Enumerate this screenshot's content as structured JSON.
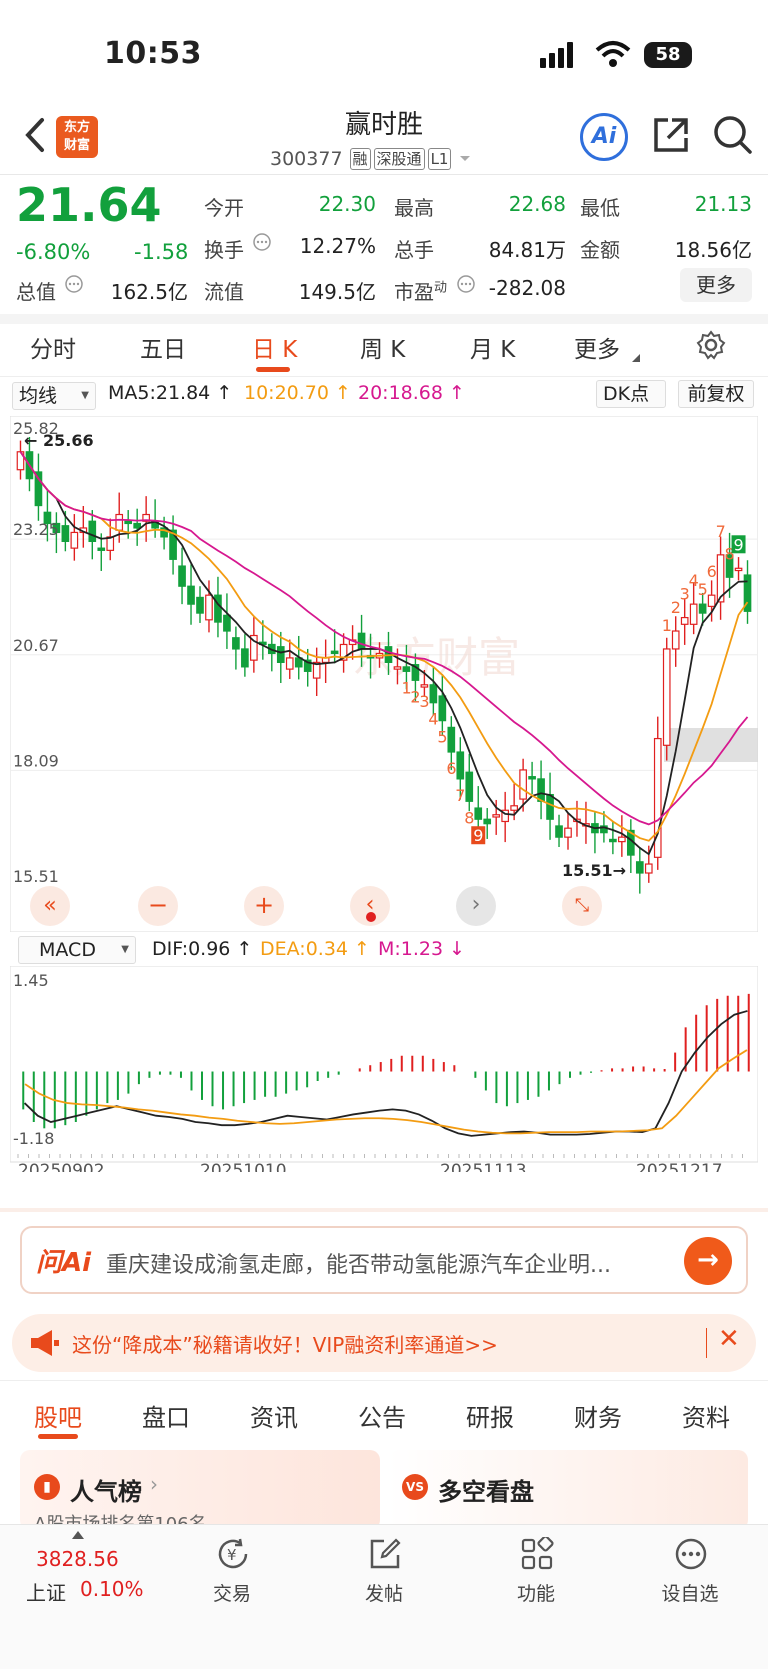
{
  "status_bar": {
    "time": "10:53",
    "battery": "58"
  },
  "header": {
    "logo_line1": "东方",
    "logo_line2": "财富",
    "stock_name": "赢时胜",
    "stock_code": "300377",
    "tags": [
      "融",
      "深股通",
      "L1"
    ]
  },
  "quote": {
    "price": "21.64",
    "change_pct": "-6.80%",
    "change": "-1.58",
    "fields": [
      {
        "label": "今开",
        "value": "22.30"
      },
      {
        "label": "最高",
        "value": "22.68"
      },
      {
        "label": "最低",
        "value": "21.13"
      },
      {
        "label": "换手",
        "value": "12.27%"
      },
      {
        "label": "总手",
        "value": "84.81万"
      },
      {
        "label": "金额",
        "value": "18.56亿"
      },
      {
        "label": "总值",
        "value": "162.5亿"
      },
      {
        "label": "流值",
        "value": "149.5亿"
      },
      {
        "label": "市盈",
        "sup": "动",
        "value": "-282.08"
      }
    ],
    "more_label": "更多"
  },
  "period_tabs": [
    "分时",
    "五日",
    "日 K",
    "周 K",
    "月 K",
    "更多"
  ],
  "active_period": 2,
  "ma_bar": {
    "selector": "均线",
    "ma5": "MA5:21.84",
    "ma10": "10:20.70",
    "ma20": "20:18.68",
    "dk": "DK点",
    "adjust": "前复权"
  },
  "macd_bar": {
    "selector": "MACD",
    "dif": "DIF:0.96",
    "dea": "DEA:0.34",
    "m": "M:1.23"
  },
  "colors": {
    "up": "#e02020",
    "down": "#12a03c",
    "ma5": "#222222",
    "ma10": "#f39c12",
    "ma20": "#d6188f",
    "accent": "#e84a1c"
  },
  "chart_data": [
    {
      "type": "candlestick",
      "ylim": [
        15.51,
        25.82
      ],
      "y_ticks": [
        "25.82",
        "23.25",
        "20.67",
        "18.09",
        "15.51"
      ],
      "annotations": {
        "high_label": "25.66",
        "low_label": "15.51",
        "signals": [
          "1",
          "2",
          "3",
          "4",
          "5",
          "6",
          "7",
          "8",
          "9",
          "1",
          "2",
          "3",
          "4",
          "5",
          "6",
          "7",
          "8",
          "9"
        ]
      },
      "x_labels": [
        "20250902",
        "20251010",
        "20251113",
        "20251217"
      ],
      "close": [
        25.2,
        24.6,
        24.0,
        23.6,
        23.4,
        23.2,
        23.4,
        23.5,
        23.2,
        23.0,
        23.3,
        23.8,
        23.6,
        23.5,
        23.8,
        23.5,
        23.3,
        22.8,
        22.2,
        21.8,
        21.6,
        22.0,
        21.4,
        21.2,
        20.8,
        20.4,
        21.1,
        20.9,
        20.7,
        20.5,
        20.6,
        20.4,
        20.3,
        20.5,
        20.6,
        20.7,
        20.9,
        21.0,
        20.8,
        20.6,
        20.7,
        20.5,
        20.4,
        20.3,
        20.1,
        20.0,
        19.6,
        19.2,
        18.5,
        17.9,
        17.4,
        17.0,
        16.9,
        17.1,
        17.2,
        17.3,
        18.1,
        17.9,
        17.4,
        17.0,
        16.6,
        16.8,
        17.0,
        16.9,
        16.7,
        16.7,
        16.5,
        16.6,
        16.2,
        15.8,
        16.0,
        18.8,
        20.8,
        21.2,
        21.5,
        21.8,
        21.6,
        22.0,
        22.9,
        22.4,
        22.6,
        21.64
      ]
    },
    {
      "type": "bar",
      "series": [
        {
          "name": "M",
          "values": [
            -0.6,
            -0.8,
            -0.9,
            -0.9,
            -0.85,
            -0.8,
            -0.7,
            -0.6,
            -0.5,
            -0.45,
            -0.35,
            -0.2,
            -0.1,
            -0.05,
            -0.05,
            -0.1,
            -0.3,
            -0.45,
            -0.55,
            -0.6,
            -0.55,
            -0.5,
            -0.45,
            -0.4,
            -0.4,
            -0.35,
            -0.3,
            -0.25,
            -0.15,
            -0.1,
            -0.05,
            0.0,
            0.05,
            0.1,
            0.15,
            0.2,
            0.25,
            0.25,
            0.25,
            0.2,
            0.15,
            0.1,
            0.0,
            -0.1,
            -0.3,
            -0.5,
            -0.55,
            -0.5,
            -0.45,
            -0.4,
            -0.3,
            -0.2,
            -0.1,
            -0.05,
            -0.02,
            0.02,
            0.05,
            0.05,
            0.08,
            0.08,
            0.05,
            0.04,
            0.3,
            0.7,
            0.9,
            1.05,
            1.15,
            1.2,
            1.2,
            1.23
          ]
        },
        {
          "name": "DIF",
          "values": [
            -0.5,
            -0.7,
            -0.8,
            -0.75,
            -0.7,
            -0.65,
            -0.6,
            -0.55,
            -0.6,
            -0.65,
            -0.7,
            -0.72,
            -0.75,
            -0.8,
            -0.82,
            -0.85,
            -0.85,
            -0.83,
            -0.8,
            -0.75,
            -0.7,
            -0.72,
            -0.74,
            -0.76,
            -0.72,
            -0.68,
            -0.65,
            -0.62,
            -0.6,
            -0.62,
            -0.68,
            -0.78,
            -0.9,
            -0.98,
            -1.02,
            -1.0,
            -0.98,
            -0.96,
            -0.95,
            -0.97,
            -1.0,
            -1.0,
            -1.0,
            -0.99,
            -0.97,
            -0.95,
            -0.95,
            -0.96,
            -0.9,
            -0.5,
            0.0,
            0.3,
            0.55,
            0.75,
            0.9,
            0.96
          ]
        },
        {
          "name": "DEA",
          "values": [
            -0.2,
            -0.35,
            -0.45,
            -0.5,
            -0.52,
            -0.53,
            -0.55,
            -0.57,
            -0.6,
            -0.62,
            -0.65,
            -0.68,
            -0.7,
            -0.73,
            -0.75,
            -0.78,
            -0.8,
            -0.82,
            -0.83,
            -0.82,
            -0.8,
            -0.78,
            -0.76,
            -0.75,
            -0.74,
            -0.74,
            -0.75,
            -0.77,
            -0.8,
            -0.84,
            -0.88,
            -0.92,
            -0.95,
            -0.97,
            -0.98,
            -0.98,
            -0.97,
            -0.96,
            -0.96,
            -0.96,
            -0.95,
            -0.95,
            -0.95,
            -0.94,
            -0.93,
            -0.9,
            -0.7,
            -0.45,
            -0.2,
            0.05,
            0.2,
            0.34
          ]
        }
      ],
      "y_ticks": [
        "1.45",
        "-1.18"
      ],
      "ylim": [
        -1.18,
        1.45
      ]
    }
  ],
  "ai_search": {
    "logo": "问Ai",
    "text": "重庆建设成渝氢走廊，能否带动氢能源汽车企业明..."
  },
  "notice": {
    "text": "这份“降成本”秘籍请收好！VIP融资利率通道>>"
  },
  "bottom_tabs": [
    "股吧",
    "盘口",
    "资讯",
    "公告",
    "研报",
    "财务",
    "资料"
  ],
  "cards": [
    {
      "title": "人气榜",
      "subtitle": "A股市场排名第106名"
    },
    {
      "title": "多空看盘"
    }
  ],
  "bottom_nav": {
    "index_value": "3828.56",
    "index_name": "上证",
    "index_pct": "0.10%",
    "items": [
      "交易",
      "发帖",
      "功能",
      "设自选"
    ]
  }
}
